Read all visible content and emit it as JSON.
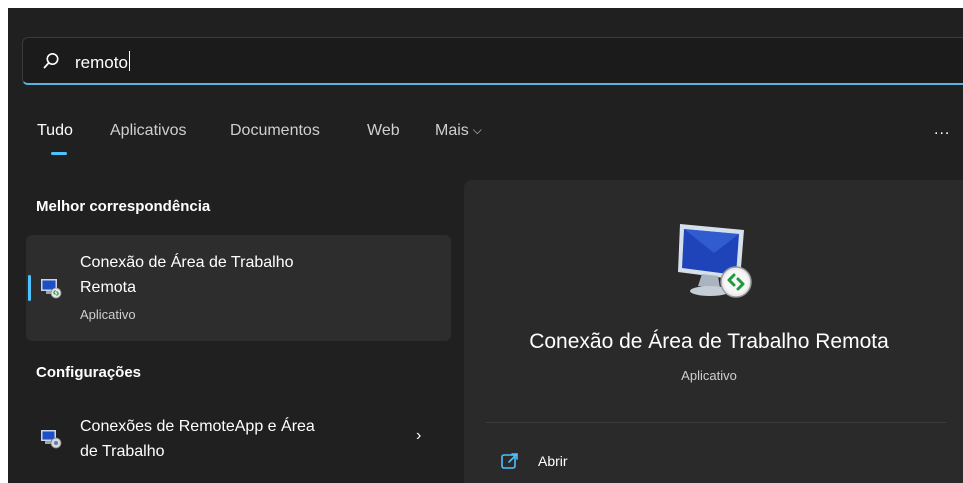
{
  "search": {
    "value": "remoto"
  },
  "tabs": [
    {
      "label": "Tudo"
    },
    {
      "label": "Aplicativos"
    },
    {
      "label": "Documentos"
    },
    {
      "label": "Web"
    },
    {
      "label": "Mais"
    }
  ],
  "more_menu": "...",
  "best_match": {
    "heading": "Melhor correspondência",
    "title_line1": "Conexão de Área de Trabalho",
    "title_line2": "Remota",
    "subtitle": "Aplicativo",
    "icon": "remote-desktop-icon"
  },
  "settings": {
    "heading": "Configurações",
    "item": {
      "title_line1": "Conexões de RemoteApp e Área",
      "title_line2": "de Trabalho",
      "icon": "remoteapp-connections-icon"
    }
  },
  "preview": {
    "title": "Conexão de Área de Trabalho Remota",
    "subtitle": "Aplicativo",
    "action_label": "Abrir"
  },
  "colors": {
    "accent": "#4cc2ff",
    "panel": "#202020",
    "card": "#2d2d2d"
  }
}
